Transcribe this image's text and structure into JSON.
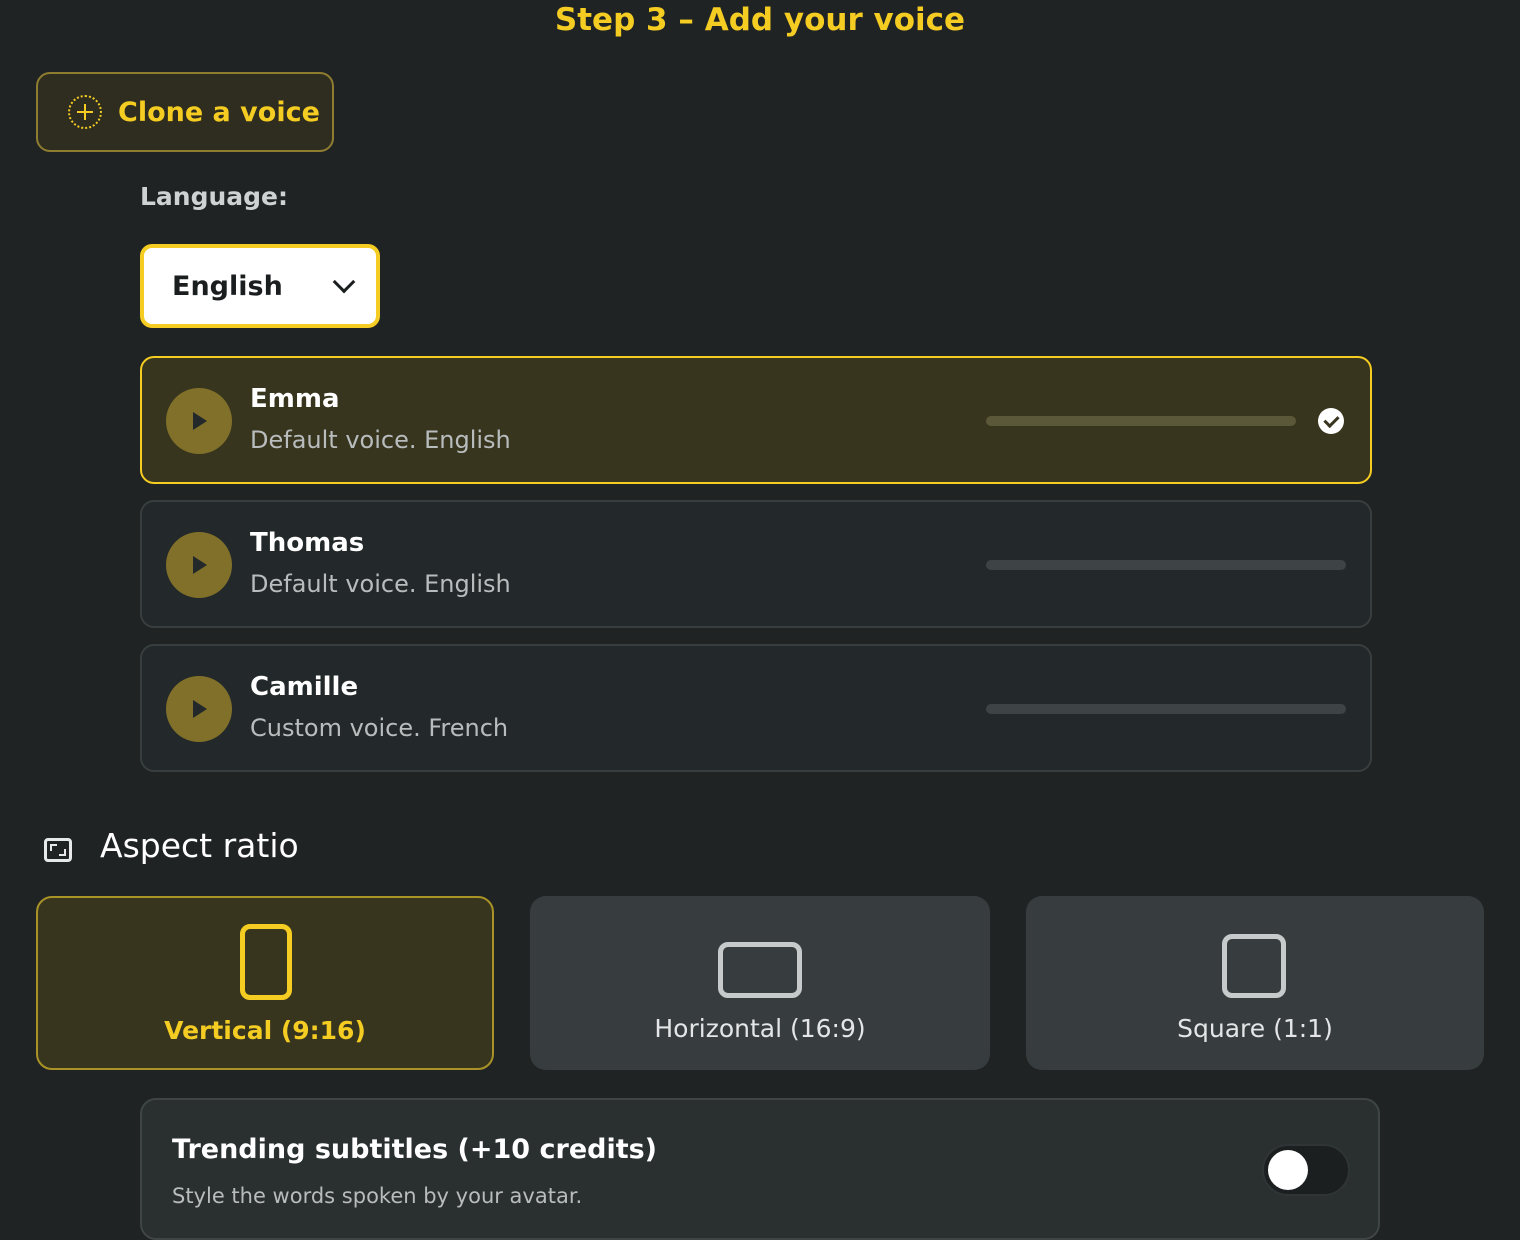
{
  "step": {
    "title": "Step 3 – Add your voice"
  },
  "clone": {
    "label": "Clone a voice"
  },
  "language": {
    "label": "Language:",
    "selected": "English"
  },
  "voices": [
    {
      "name": "Emma",
      "description": "Default voice. English",
      "selected": true
    },
    {
      "name": "Thomas",
      "description": "Default voice. English",
      "selected": false
    },
    {
      "name": "Camille",
      "description": "Custom voice. French",
      "selected": false
    }
  ],
  "aspect": {
    "title": "Aspect ratio",
    "options": [
      {
        "label": "Vertical (9:16)",
        "selected": true
      },
      {
        "label": "Horizontal (16:9)",
        "selected": false
      },
      {
        "label": "Square (1:1)",
        "selected": false
      }
    ]
  },
  "subtitles": {
    "title": "Trending subtitles (+10 credits)",
    "description": "Style the words spoken by your avatar.",
    "enabled": false
  },
  "colors": {
    "accent": "#f5cc22",
    "background": "#1f2324",
    "selected_bg": "#38351f"
  }
}
